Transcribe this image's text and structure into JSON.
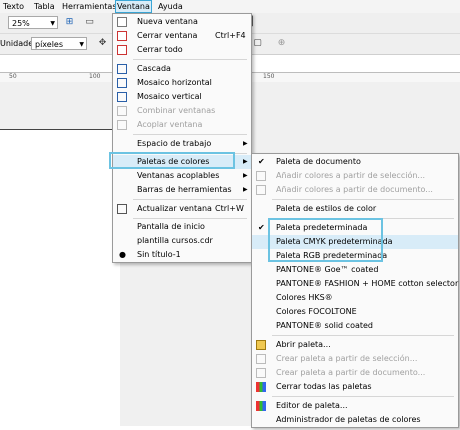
{
  "menubar": {
    "items": [
      "Texto",
      "Tabla",
      "Herramientas",
      "Ventana",
      "Ayuda"
    ]
  },
  "toolbar": {
    "zoom": "25%",
    "units_label": "Unidades:",
    "units": "píxeles"
  },
  "ruler": {
    "ticks": [
      "50",
      "100",
      "150"
    ]
  },
  "ventana_menu": {
    "items": [
      {
        "label": "Nueva ventana",
        "shortcut": ""
      },
      {
        "label": "Cerrar ventana",
        "shortcut": "Ctrl+F4"
      },
      {
        "label": "Cerrar todo",
        "shortcut": ""
      },
      {
        "label": "Cascada",
        "shortcut": ""
      },
      {
        "label": "Mosaico horizontal",
        "shortcut": ""
      },
      {
        "label": "Mosaico vertical",
        "shortcut": ""
      },
      {
        "label": "Combinar ventanas",
        "shortcut": ""
      },
      {
        "label": "Acoplar ventana",
        "shortcut": ""
      },
      {
        "label": "Espacio de trabajo",
        "shortcut": ""
      },
      {
        "label": "Paletas de colores",
        "shortcut": ""
      },
      {
        "label": "Ventanas acoplables",
        "shortcut": ""
      },
      {
        "label": "Barras de herramientas",
        "shortcut": ""
      },
      {
        "label": "Actualizar ventana",
        "shortcut": "Ctrl+W"
      },
      {
        "label": "Pantalla de inicio",
        "shortcut": ""
      },
      {
        "label": "plantilla cursos.cdr",
        "shortcut": ""
      },
      {
        "label": "Sin título-1",
        "shortcut": ""
      }
    ]
  },
  "paletas_menu": {
    "items": [
      {
        "label": "Paleta de documento"
      },
      {
        "label": "Añadir colores a partir de selección..."
      },
      {
        "label": "Añadir colores a partir de documento..."
      },
      {
        "label": "Paleta de estilos de color"
      },
      {
        "label": "Paleta predeterminada"
      },
      {
        "label": "Paleta CMYK predeterminada"
      },
      {
        "label": "Paleta RGB predeterminada"
      },
      {
        "label": "PANTONE® Goe™ coated"
      },
      {
        "label": "PANTONE® FASHION + HOME cotton selector"
      },
      {
        "label": "Colores HKS®"
      },
      {
        "label": "Colores FOCOLTONE"
      },
      {
        "label": "PANTONE® solid coated"
      },
      {
        "label": "Abrir paleta..."
      },
      {
        "label": "Crear paleta a partir de selección..."
      },
      {
        "label": "Crear paleta a partir de documento..."
      },
      {
        "label": "Cerrar todas las paletas"
      },
      {
        "label": "Editor de paleta..."
      },
      {
        "label": "Administrador de paletas de colores"
      }
    ]
  },
  "colors": {
    "highlight": "#d8ecf8",
    "callout": "#6cc3e2"
  }
}
